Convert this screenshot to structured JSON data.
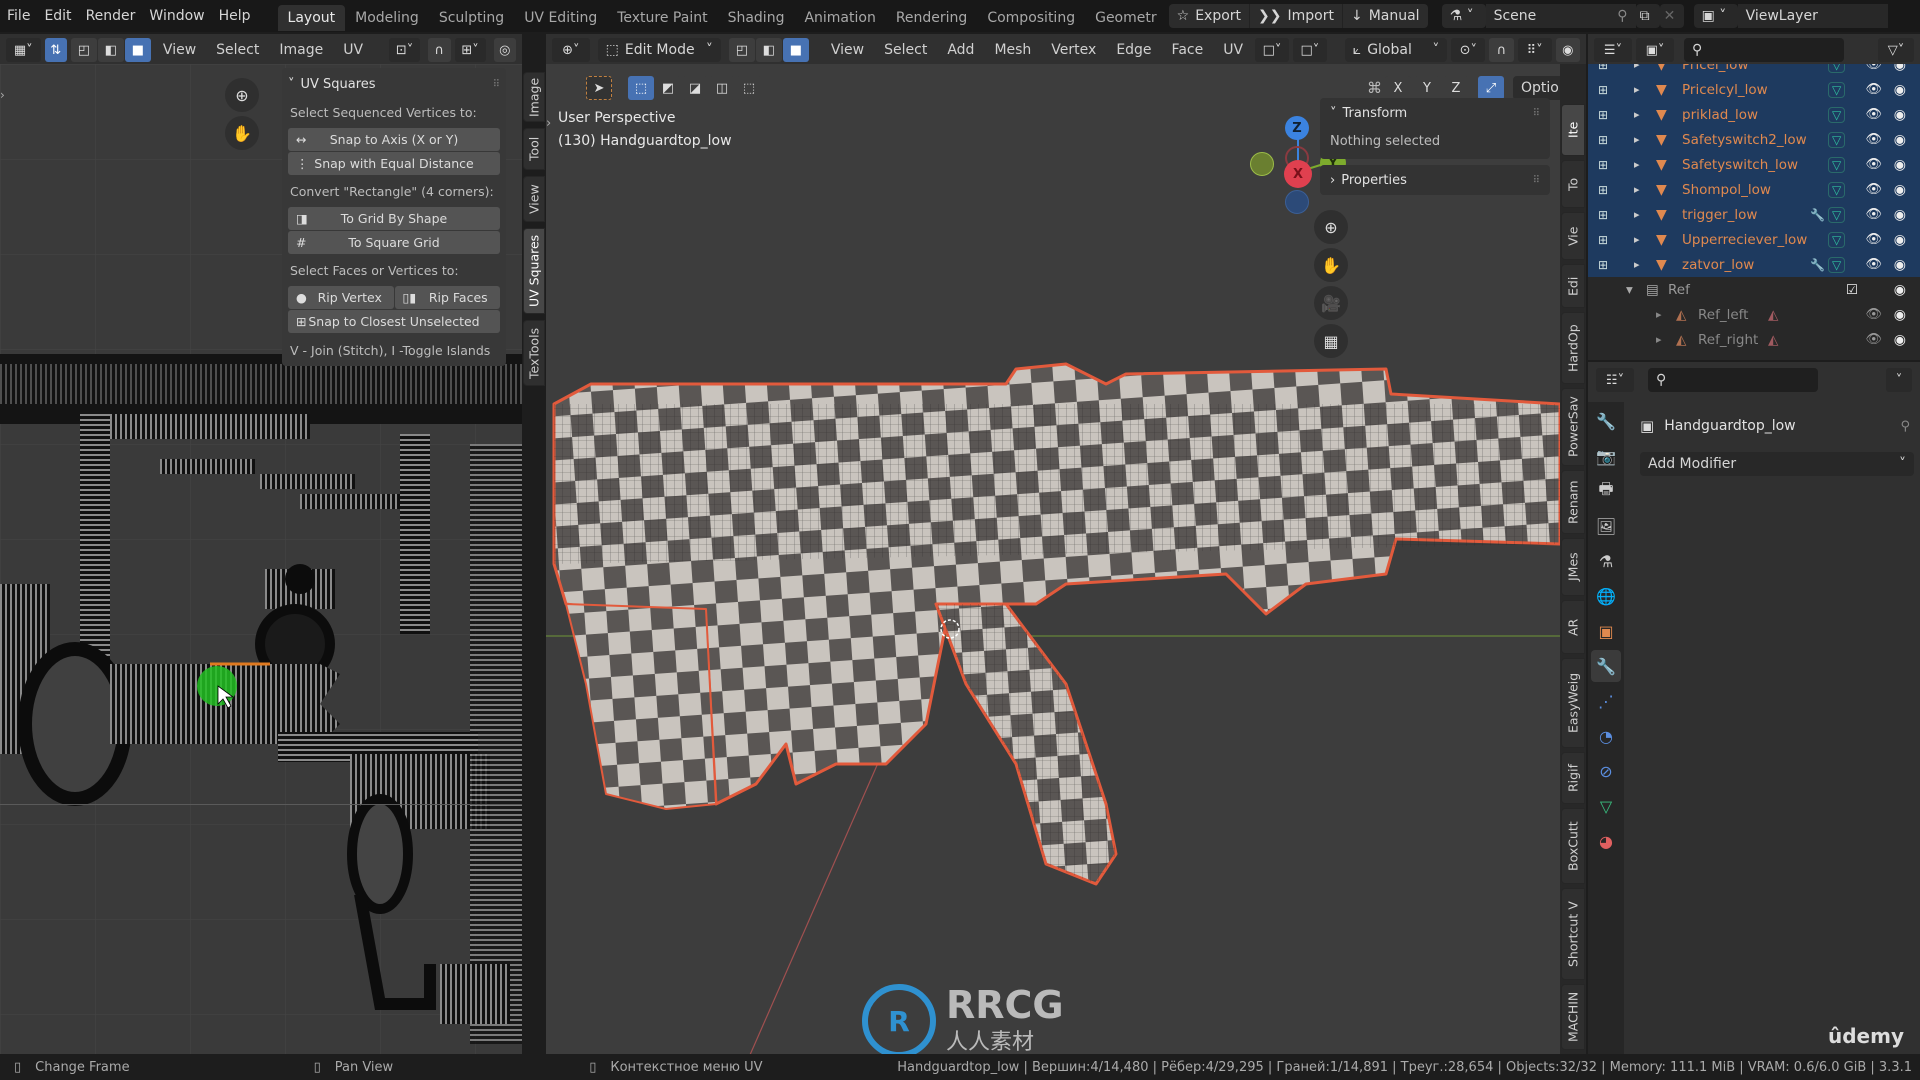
{
  "topbar": {
    "menus": [
      "File",
      "Edit",
      "Render",
      "Window",
      "Help"
    ],
    "workspaces": [
      "Layout",
      "Modeling",
      "Sculpting",
      "UV Editing",
      "Texture Paint",
      "Shading",
      "Animation",
      "Rendering",
      "Compositing",
      "Geometr"
    ],
    "active_workspace": "Layout",
    "addon_buttons": {
      "export": "Export",
      "import": "Import",
      "manual": "Manual"
    },
    "scene": "Scene",
    "view_layer": "ViewLayer"
  },
  "uv_editor": {
    "header_menus": [
      "View",
      "Select",
      "Image",
      "UV"
    ],
    "panel": {
      "title": "UV Squares",
      "section1_label": "Select Sequenced Vertices to:",
      "snap_axis": "Snap to Axis (X or Y)",
      "snap_equal": "Snap with Equal Distance",
      "section2_label": "Convert \"Rectangle\" (4 corners):",
      "grid_by_shape": "To Grid By Shape",
      "square_grid": "To Square Grid",
      "section3_label": "Select Faces or Vertices to:",
      "rip_vertex": "Rip Vertex",
      "rip_faces": "Rip Faces",
      "snap_closest": "Snap to Closest Unselected",
      "hint": "V - Join (Stitch), I -Toggle Islands"
    },
    "side_tabs": [
      "Image",
      "Tool",
      "View",
      "UV Squares",
      "TexTools"
    ],
    "active_side_tab": "UV Squares"
  },
  "viewport": {
    "mode": "Edit Mode",
    "header_menus": [
      "View",
      "Select",
      "Add",
      "Mesh",
      "Vertex",
      "Edge",
      "Face",
      "UV"
    ],
    "transform_orientation": "Global",
    "mirror_axes": [
      "X",
      "Y",
      "Z"
    ],
    "options_label": "Options",
    "view_name": "User Perspective",
    "object_info": "(130) Handguardtop_low",
    "gizmo_axes": {
      "x": "X",
      "y": "Y",
      "z": "Z"
    },
    "npanel": {
      "transform_title": "Transform",
      "transform_body": "Nothing selected",
      "properties_title": "Properties"
    },
    "side_tabs": [
      "Ite",
      "To",
      "Vie",
      "Edi",
      "HardOp",
      "PowerSav",
      "Renam",
      "JMes",
      "AR",
      "EasyWeig",
      "Rigif",
      "BoxCutt",
      "Shortcut V",
      "MACHIN"
    ],
    "active_side_tab": "Ite"
  },
  "outliner": {
    "items": [
      {
        "name": "Pricel_low",
        "selected": true,
        "modifier": false
      },
      {
        "name": "Pricelcyl_low",
        "selected": true,
        "modifier": false
      },
      {
        "name": "priklad_low",
        "selected": true,
        "modifier": false
      },
      {
        "name": "Safetyswitch2_low",
        "selected": true,
        "modifier": false
      },
      {
        "name": "Safetyswitch_low",
        "selected": true,
        "modifier": false
      },
      {
        "name": "Shompol_low",
        "selected": true,
        "modifier": false
      },
      {
        "name": "trigger_low",
        "selected": true,
        "modifier": true
      },
      {
        "name": "Upperreciever_low",
        "selected": true,
        "modifier": false
      },
      {
        "name": "zatvor_low",
        "selected": true,
        "modifier": true
      }
    ],
    "collection": "Ref",
    "collection_children": [
      "Ref_left",
      "Ref_right"
    ]
  },
  "properties": {
    "object_name": "Handguardtop_low",
    "add_modifier": "Add Modifier"
  },
  "status_bar": {
    "hint1": "Change Frame",
    "hint2": "Pan View",
    "hint3": "Контекстное меню UV",
    "stats": "Handguardtop_low | Вершин:4/14,480 | Рёбер:4/29,295 | Граней:1/14,891 | Треуг.:28,654 | Objects:32/32 | Memory: 111.1 MiB | VRAM: 0.6/6.0 GiB | 3.3.1"
  },
  "watermarks": {
    "brand": "RRCG",
    "brand_cn": "人人素材",
    "udemy": "ûdemy"
  },
  "colors": {
    "accent": "#4772b3",
    "selected_row": "#1e3a5f",
    "object_orange": "#e0894f",
    "axis_x": "#e0404f",
    "axis_y": "#7dab2d",
    "axis_z": "#3b83e0"
  }
}
